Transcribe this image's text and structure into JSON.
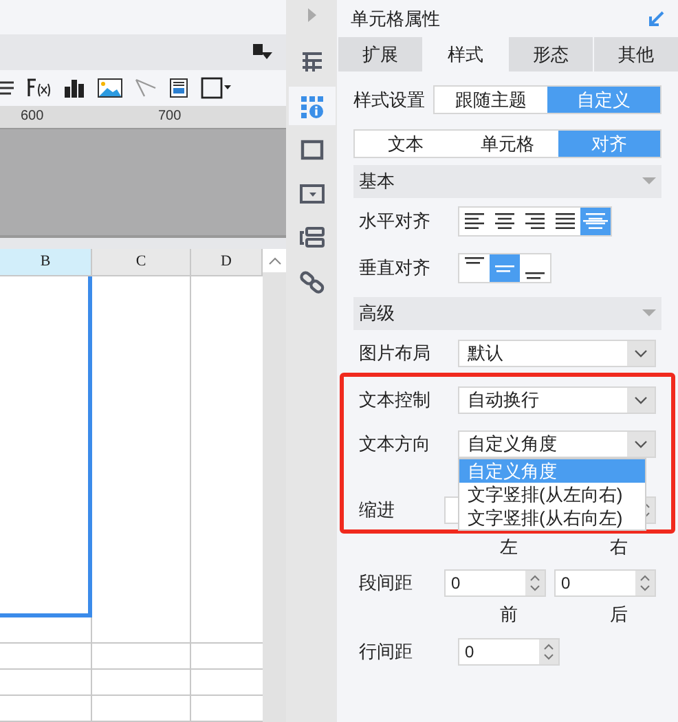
{
  "ruler": {
    "labels": [
      "600",
      "700"
    ]
  },
  "sheet": {
    "columns": [
      {
        "label": "B",
        "selected": true
      },
      {
        "label": "C",
        "selected": false
      },
      {
        "label": "D",
        "selected": false
      }
    ]
  },
  "sidebar": {
    "items": [
      {
        "kind": "grid",
        "selected": false
      },
      {
        "kind": "info",
        "selected": true
      },
      {
        "kind": "square",
        "selected": false
      },
      {
        "kind": "dropdown",
        "selected": false
      },
      {
        "kind": "form",
        "selected": false
      },
      {
        "kind": "link",
        "selected": false
      }
    ]
  },
  "panel": {
    "title": "单元格属性",
    "tabs": [
      {
        "label": "扩展",
        "selected": false
      },
      {
        "label": "样式",
        "selected": true
      },
      {
        "label": "形态",
        "selected": false
      },
      {
        "label": "其他",
        "selected": false
      }
    ],
    "style_setting": {
      "label": "样式设置",
      "options": [
        {
          "label": "跟随主题",
          "selected": false
        },
        {
          "label": "自定义",
          "selected": true
        }
      ]
    },
    "subtabs": [
      {
        "label": "文本",
        "selected": false
      },
      {
        "label": "单元格",
        "selected": false
      },
      {
        "label": "对齐",
        "selected": true
      }
    ],
    "basic": {
      "title": "基本",
      "horizontal": {
        "label": "水平对齐",
        "options": [
          {
            "kind": "left",
            "selected": false
          },
          {
            "kind": "center",
            "selected": false
          },
          {
            "kind": "right",
            "selected": false
          },
          {
            "kind": "justify",
            "selected": false
          },
          {
            "kind": "distributed",
            "selected": true
          }
        ]
      },
      "vertical": {
        "label": "垂直对齐",
        "options": [
          {
            "kind": "top",
            "selected": false
          },
          {
            "kind": "middle",
            "selected": true
          },
          {
            "kind": "bottom",
            "selected": false
          }
        ]
      }
    },
    "advanced": {
      "title": "高级",
      "image_layout": {
        "label": "图片布局",
        "value": "默认"
      },
      "text_control": {
        "label": "文本控制",
        "value": "自动换行"
      },
      "text_direction": {
        "label": "文本方向",
        "value": "自定义角度",
        "open": true,
        "options": [
          {
            "label": "自定义角度",
            "selected": true
          },
          {
            "label": "文字竖排(从左向右)",
            "selected": false
          },
          {
            "label": "文字竖排(从右向左)",
            "selected": false
          }
        ]
      },
      "indent": {
        "label": "缩进",
        "sublabels": [
          "左",
          "右"
        ]
      },
      "paragraph_spacing": {
        "label": "段间距",
        "values": [
          "0",
          "0"
        ],
        "sublabels": [
          "前",
          "后"
        ]
      },
      "line_spacing": {
        "label": "行间距",
        "value": "0"
      }
    }
  }
}
